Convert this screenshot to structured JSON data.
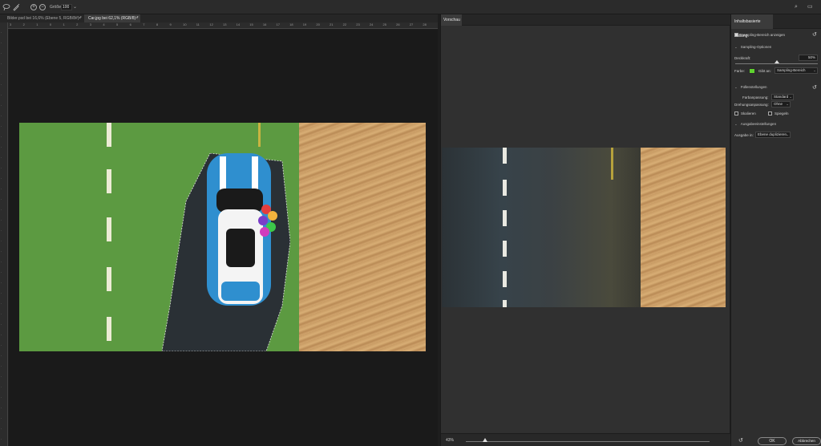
{
  "toolbar": {
    "size_label": "Größe:",
    "size_value": "100",
    "add_symbol": "+",
    "subtract_symbol": "−",
    "icons": [
      "lasso-tool-icon",
      "brush-tool-icon",
      "add-mode-icon",
      "subtract-mode-icon",
      "search-icon",
      "workspace-icon"
    ]
  },
  "tabs": [
    {
      "label": "Bilder.psd bei 16,6% (Ebene 5, RGB/8#) *",
      "active": false
    },
    {
      "label": "Car.jpg bei 62,1% (RGB/8) *",
      "active": true
    }
  ],
  "ruler": {
    "top": [
      "3",
      "2",
      "1",
      "0",
      "1",
      "2",
      "3",
      "4",
      "5",
      "6",
      "7",
      "8",
      "9",
      "10",
      "11",
      "12",
      "13",
      "14",
      "15",
      "16",
      "17",
      "18",
      "19",
      "20",
      "21",
      "22",
      "23",
      "24",
      "25",
      "26",
      "27",
      "28"
    ]
  },
  "preview": {
    "tab_label": "Vorschau",
    "zoom_label": "43%",
    "zoom_fraction": 0.08
  },
  "panel": {
    "tab_label": "Inhaltsbasierte Füllung",
    "show_sampling_label": "Sampling-Bereich anzeigen",
    "show_sampling_checked": true,
    "sampling_options_header": "Sampling-Optionen",
    "opacity_label": "Deckkraft:",
    "opacity_value": "50%",
    "opacity_fraction": 0.5,
    "color_label": "Farbe:",
    "color_hex": "#5fd22f",
    "indicates_label": "Gibt an:",
    "indicates_value": "Sampling-Bereich",
    "fill_settings_header": "Füllenstellungen",
    "color_adapt_label": "Farbanpassung:",
    "color_adapt_value": "Standard",
    "rotation_adapt_label": "Drehungsanpassung:",
    "rotation_adapt_value": "Ohne",
    "scale_label": "Skalieren",
    "scale_checked": false,
    "mirror_label": "Spiegeln",
    "mirror_checked": false,
    "output_header": "Ausgabeeinstellungen",
    "output_label": "Ausgabe in:",
    "output_value": "Ebene duplizieren",
    "ok_label": "OK",
    "cancel_label": "Abbrechen"
  }
}
